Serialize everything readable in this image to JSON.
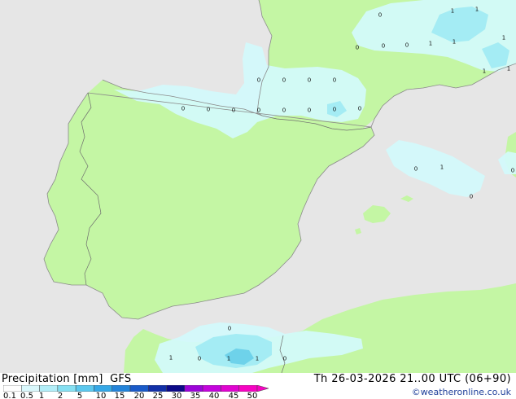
{
  "title": {
    "variable": "Precipitation [mm]",
    "model": "GFS"
  },
  "valid_time": "Th 26-03-2026 21..00 UTC (06+90)",
  "credit": "©weatheronline.co.uk",
  "colors": {
    "sea": "#e6e6e6",
    "land": "#c4f6a4",
    "precip_light": "#d2fafc",
    "precip_medium": "#a4ecf4",
    "precip_heavy": "#6ed2ea",
    "coast": "#8a8a8a",
    "border": "#6e6e6e"
  },
  "legend": {
    "labels": [
      "0.1",
      "0.5",
      "1",
      "2",
      "5",
      "10",
      "15",
      "20",
      "25",
      "30",
      "35",
      "40",
      "45",
      "50"
    ],
    "colors": [
      "#fefefe",
      "#daf8fc",
      "#b2eef8",
      "#86e0f2",
      "#5cc8ee",
      "#36a8e6",
      "#2484da",
      "#1a5ac8",
      "#1230a8",
      "#0c0a88",
      "#9c04d8",
      "#c404dc",
      "#e004d0",
      "#f604c2"
    ]
  },
  "map_values": [
    "0",
    "1",
    "1",
    "1",
    "1",
    "0",
    "0",
    "0",
    "1",
    "1",
    "1",
    "0",
    "0",
    "0",
    "0",
    "0",
    "0",
    "0",
    "0",
    "0",
    "0",
    "0",
    "0",
    "1",
    "0",
    "0",
    "0",
    "0",
    "1",
    "0",
    "1",
    "1",
    "0"
  ]
}
